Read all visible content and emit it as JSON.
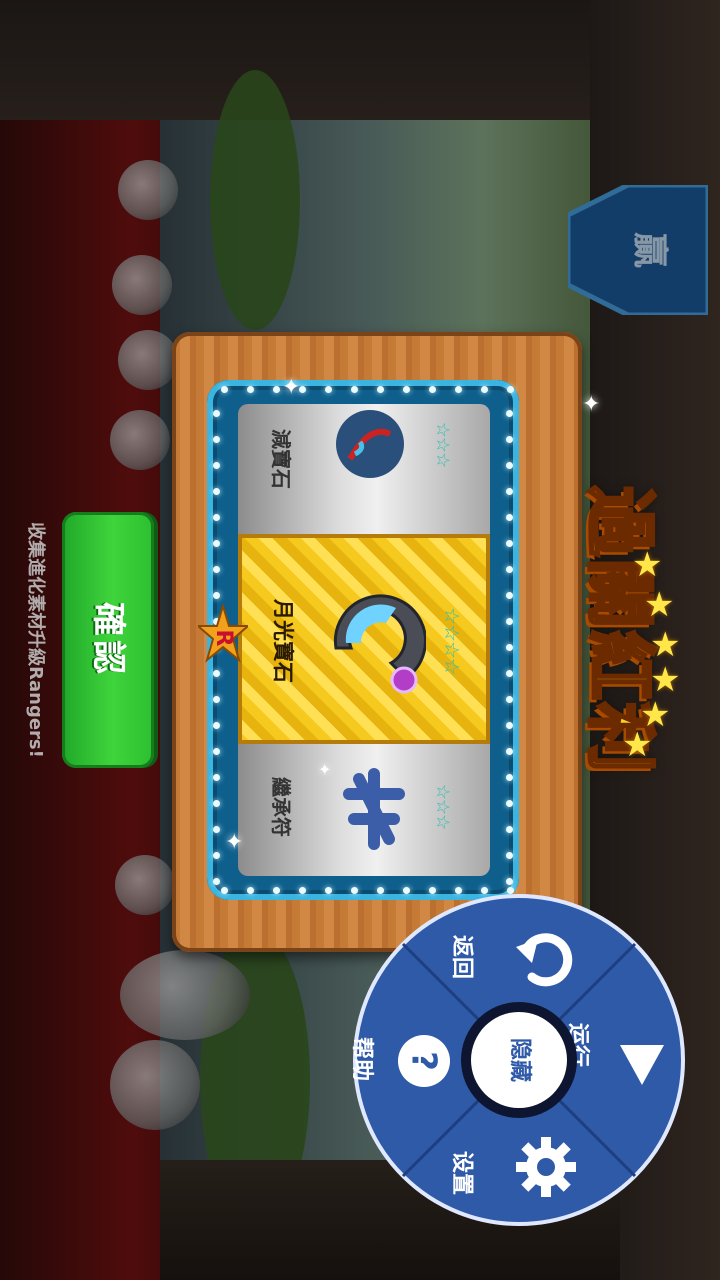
{
  "dialog": {
    "title": "過關紅利",
    "confirm_label": "確認",
    "reels": [
      {
        "name": "減寶石",
        "stars": "☆☆☆"
      },
      {
        "name": "月光寶石",
        "stars": "☆☆☆☆"
      },
      {
        "name": "繼承符",
        "stars": "☆☆☆"
      }
    ],
    "rarity_badge": "R"
  },
  "background": {
    "pennant_text": "贏",
    "tip_text": "收集進化素材升級Rangers!"
  },
  "radial_menu": {
    "center_label": "隐藏",
    "items": {
      "back": "返回",
      "run": "运行",
      "settings": "设置",
      "help": "帮助"
    }
  },
  "colors": {
    "menu_blue": "#2f5aa8",
    "confirm_green": "#3fd43b",
    "title_gold": "#ffd21f"
  }
}
